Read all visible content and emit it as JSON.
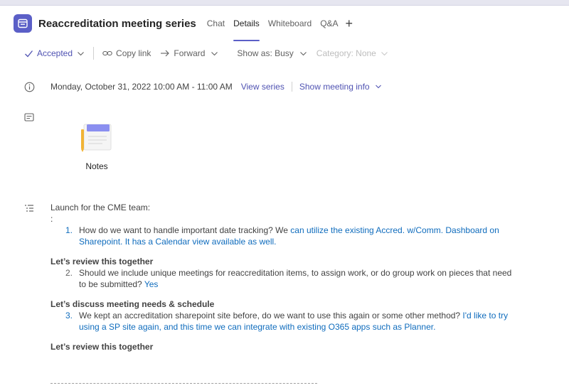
{
  "meeting": {
    "title": "Reaccreditation meeting series",
    "tabs": [
      {
        "label": "Chat"
      },
      {
        "label": "Details"
      },
      {
        "label": "Whiteboard"
      },
      {
        "label": "Q&A"
      }
    ],
    "add_tab_glyph": "+"
  },
  "toolbar": {
    "accepted": "Accepted",
    "copy_link": "Copy link",
    "forward": "Forward",
    "show_as": "Show as: Busy",
    "category": "Category: None"
  },
  "info": {
    "datetime": "Monday, October 31, 2022 10:00 AM - 11:00 AM",
    "view_series": "View series",
    "show_meeting_info": "Show meeting info"
  },
  "notes": {
    "label": "Notes"
  },
  "description": {
    "intro": "Launch for the CME team:",
    "colon": ":",
    "items": [
      {
        "num": "1.",
        "text_plain": "How do we want to handle important date tracking? W",
        "text_plain2": "e",
        "text_blue": " can utilize the existing Accred. w/Comm. Dashboard on Sharepoint. It has a Calendar view available as well."
      },
      {
        "num": "2.",
        "text_plain": "Should we include unique meetings for reaccreditation items, to assign work, or do group work on pieces that need to be submitted?",
        "text_blue": " Yes"
      },
      {
        "num": "3.",
        "text_plain": "We kept an accreditation sharepoint site before, do we want to use this again or some other method?",
        "text_blue": " I'd like to try using a SP site again, and this time we can integrate with existing O365 apps such as Planner."
      }
    ],
    "heading1": "Let’s review this together",
    "heading2": "Let’s discuss meeting needs & schedule",
    "heading3": "Let’s review this together"
  },
  "icons": {
    "app": "calendar-icon",
    "accepted": "checkmark-icon",
    "copy_link": "link-icon",
    "forward": "arrow-right-icon",
    "info": "info-icon",
    "notes_section": "notes-section-icon",
    "description": "list-icon"
  },
  "colors": {
    "accent": "#5b5fc7",
    "link": "#4f52b2",
    "answer": "#0f6cbd"
  }
}
